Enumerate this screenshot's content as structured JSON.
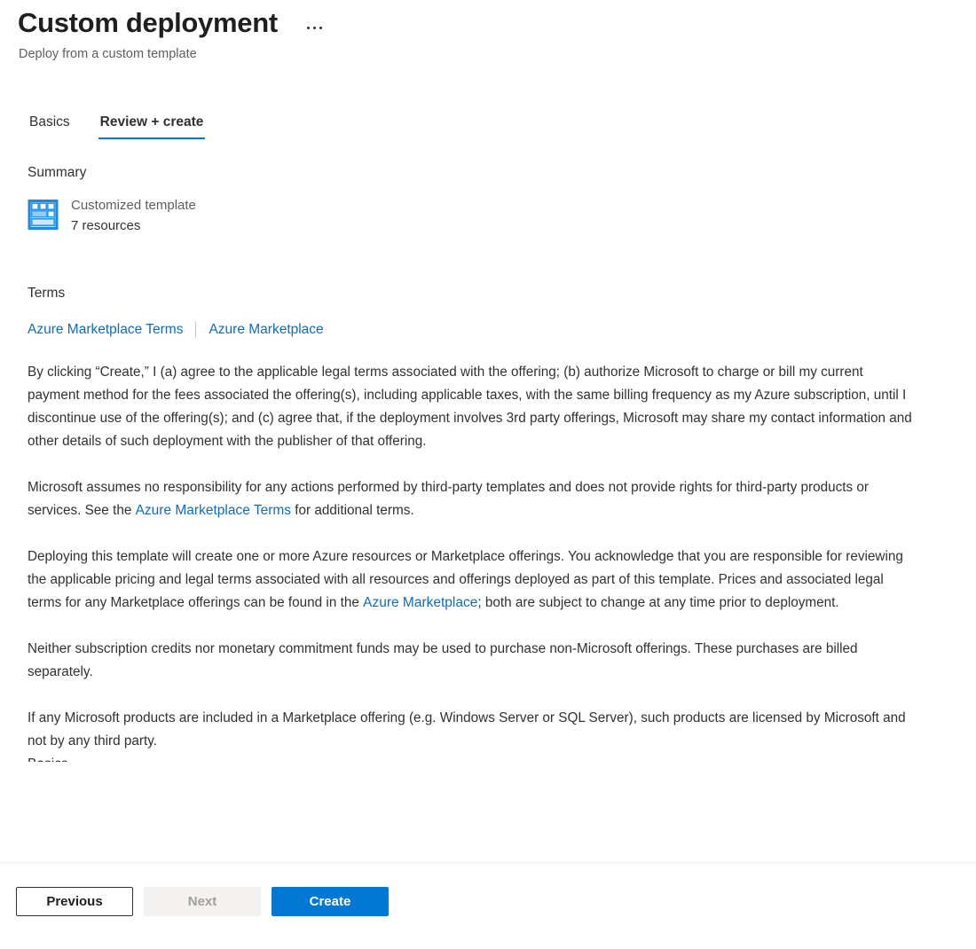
{
  "header": {
    "title": "Custom deployment",
    "subtitle": "Deploy from a custom template",
    "more_menu_label": "More options"
  },
  "tabs": [
    {
      "label": "Basics",
      "active": false
    },
    {
      "label": "Review + create",
      "active": true
    }
  ],
  "summary": {
    "section_title": "Summary",
    "icon": "template-grid-icon",
    "template_name": "Customized template",
    "resource_count": "7 resources"
  },
  "terms": {
    "section_title": "Terms",
    "links": [
      {
        "label": "Azure Marketplace Terms"
      },
      {
        "label": "Azure Marketplace"
      }
    ],
    "paragraphs": {
      "p1": "By clicking “Create,” I (a) agree to the applicable legal terms associated with the offering; (b) authorize Microsoft to charge or bill my current payment method for the fees associated the offering(s), including applicable taxes, with the same billing frequency as my Azure subscription, until I discontinue use of the offering(s); and (c) agree that, if the deployment involves 3rd party offerings, Microsoft may share my contact information and other details of such deployment with the publisher of that offering.",
      "p2_before": "Microsoft assumes no responsibility for any actions performed by third-party templates and does not provide rights for third-party products or services. See the ",
      "p2_link": "Azure Marketplace Terms",
      "p2_after": " for additional terms.",
      "p3_before": "Deploying this template will create one or more Azure resources or Marketplace offerings.  You acknowledge that you are responsible for reviewing the applicable pricing and legal terms associated with all resources and offerings deployed as part of this template.  Prices and associated legal terms for any Marketplace offerings can be found in the ",
      "p3_link": "Azure Marketplace",
      "p3_after": "; both are subject to change at any time prior to deployment.",
      "p4": "Neither subscription credits nor monetary commitment funds may be used to purchase non-Microsoft offerings. These purchases are billed separately.",
      "p5": "If any Microsoft products are included in a Marketplace offering (e.g. Windows Server or SQL Server), such products are licensed by Microsoft and not by any third party."
    },
    "cut_off_heading": "Basics"
  },
  "footer": {
    "previous_label": "Previous",
    "next_label": "Next",
    "create_label": "Create"
  },
  "colors": {
    "accent": "#0078d4",
    "link": "#0f6cbd",
    "text": "#323130",
    "muted": "#605e5c",
    "disabled_bg": "#f3f2f1",
    "disabled_text": "#a19f9d",
    "divider": "#edebe9"
  }
}
